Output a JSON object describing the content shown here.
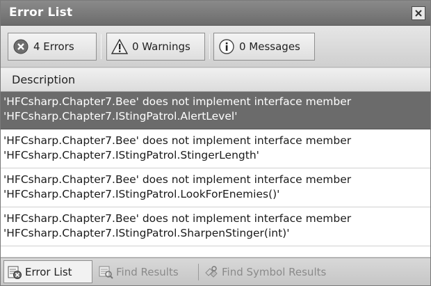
{
  "window": {
    "title": "Error List"
  },
  "toolbar": {
    "errors_label": "4 Errors",
    "warnings_label": "0 Warnings",
    "messages_label": "0 Messages"
  },
  "table": {
    "column_description": "Description",
    "rows": [
      {
        "line1": "'HFCsharp.Chapter7.Bee' does not implement interface member",
        "line2": "'HFCsharp.Chapter7.IStingPatrol.AlertLevel'",
        "selected": true
      },
      {
        "line1": "'HFCsharp.Chapter7.Bee' does not implement interface member",
        "line2": "'HFCsharp.Chapter7.IStingPatrol.StingerLength'"
      },
      {
        "line1": "'HFCsharp.Chapter7.Bee' does not implement interface member",
        "line2": "'HFCsharp.Chapter7.IStingPatrol.LookForEnemies()'"
      },
      {
        "line1": "'HFCsharp.Chapter7.Bee' does not implement interface member",
        "line2": "'HFCsharp.Chapter7.IStingPatrol.SharpenStinger(int)'"
      }
    ]
  },
  "bottom_tabs": {
    "error_list": "Error List",
    "find_results": "Find Results",
    "find_symbol_results": "Find Symbol Results"
  }
}
